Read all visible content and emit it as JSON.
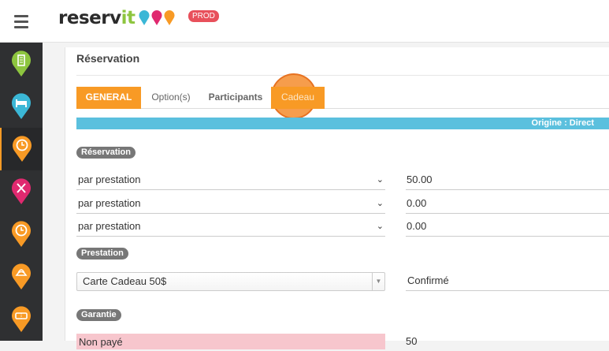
{
  "header": {
    "logo_text_main": "reserv",
    "logo_text_accent": "it",
    "env_badge": "PROD"
  },
  "sidebar": {
    "items": [
      {
        "icon": "building-pin-icon",
        "color": "#8dc53f"
      },
      {
        "icon": "bed-pin-icon",
        "color": "#3bb7d6"
      },
      {
        "icon": "clock-pin-icon",
        "color": "#f89a25",
        "active": true
      },
      {
        "icon": "restaurant-pin-icon",
        "color": "#e0296f"
      },
      {
        "icon": "clock-pin-icon",
        "color": "#f89a25"
      },
      {
        "icon": "spa-pin-icon",
        "color": "#f89a25"
      },
      {
        "icon": "ticket-pin-icon",
        "color": "#f89a25"
      }
    ]
  },
  "page": {
    "title": "Réservation"
  },
  "tabs": [
    {
      "label": "GENERAL",
      "active": true
    },
    {
      "label": "Option(s)"
    },
    {
      "label": "Participants"
    },
    {
      "label": "Cadeau",
      "highlighted": true
    }
  ],
  "origin_label": "Origine : Direct",
  "reservation_section": {
    "badge": "Réservation",
    "rows": [
      {
        "select": "par prestation",
        "value": "50.00"
      },
      {
        "select": "par prestation",
        "value": "0.00"
      },
      {
        "select": "par prestation",
        "value": "0.00"
      }
    ]
  },
  "prestation_section": {
    "badge": "Prestation",
    "selected": "Carte Cadeau 50$",
    "status": "Confirmé"
  },
  "garantie_section": {
    "badge": "Garantie",
    "payment_status": "Non payé",
    "amount": "50"
  },
  "colors": {
    "accent": "#f89a25",
    "info": "#5bc0de",
    "danger_light": "#f7c6cd",
    "brand_green": "#8dc53f"
  }
}
